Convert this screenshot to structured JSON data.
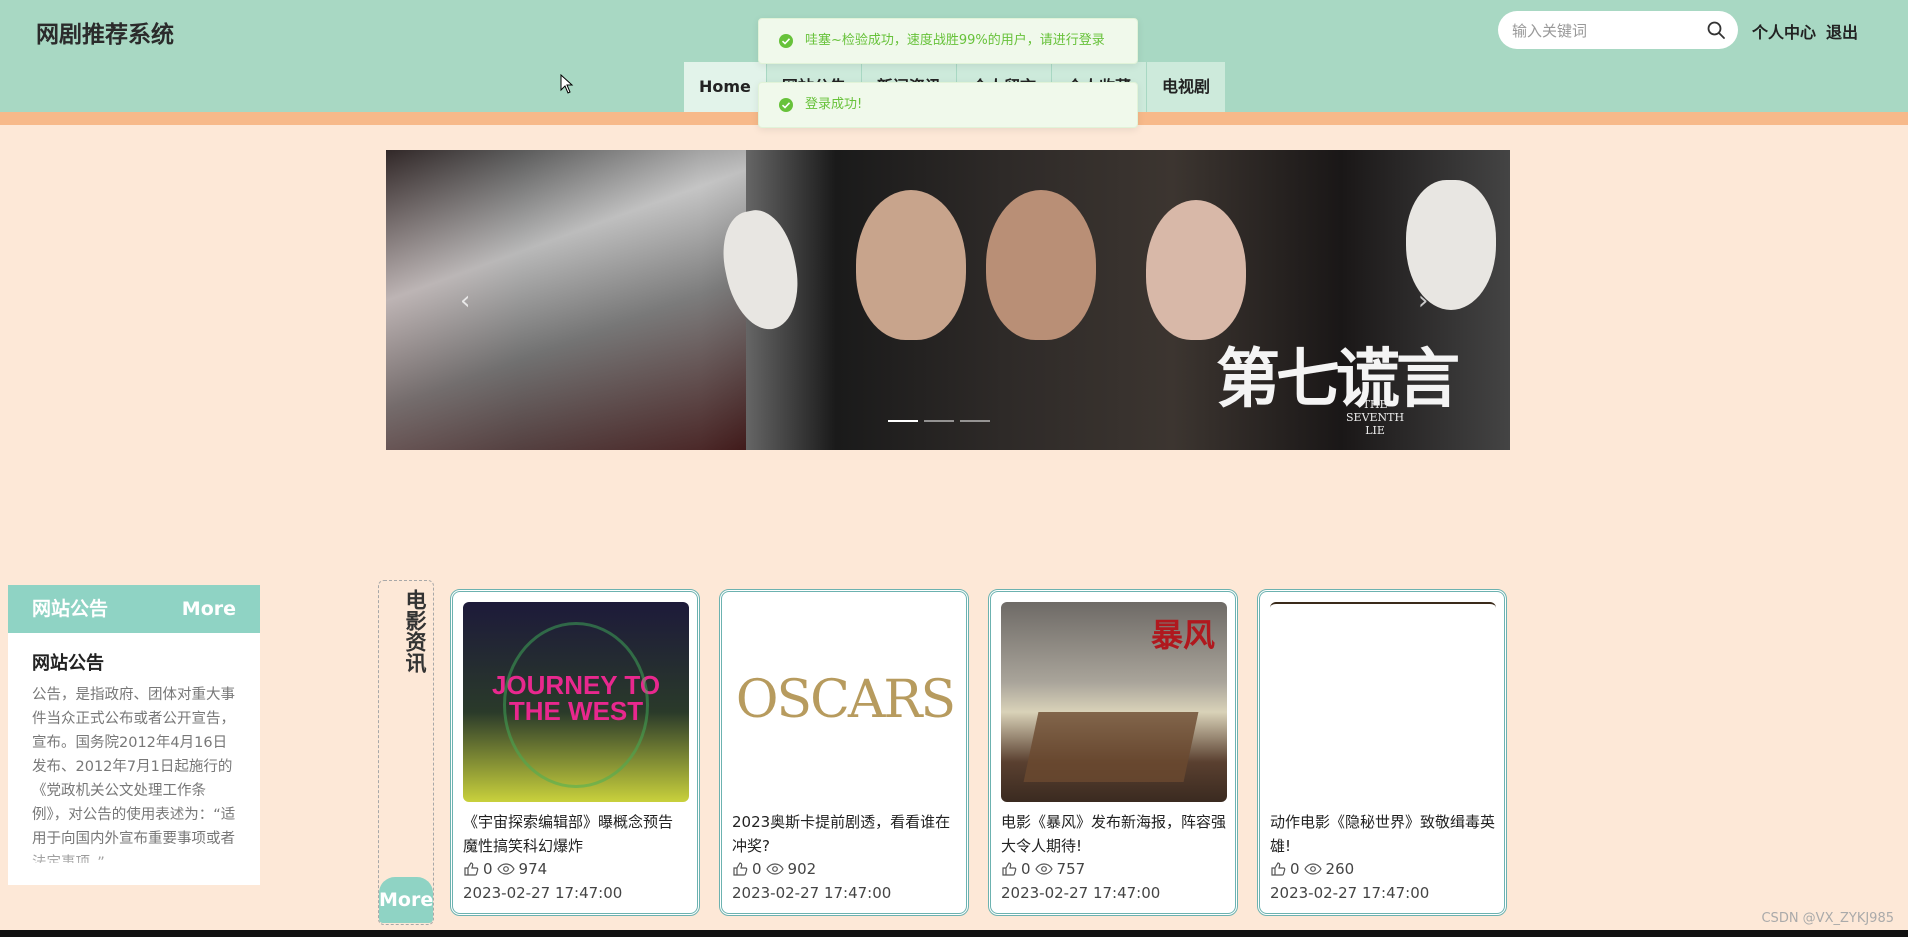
{
  "header": {
    "title": "网剧推荐系统",
    "search_placeholder": "输入关键词",
    "user_center": "个人中心",
    "logout": "退出"
  },
  "nav": {
    "items": [
      {
        "label": "Home"
      },
      {
        "label": "网站公告"
      },
      {
        "label": "新闻资讯"
      },
      {
        "label": "个人留言"
      },
      {
        "label": "个人收藏"
      },
      {
        "label": "电视剧"
      }
    ]
  },
  "toasts": [
    {
      "text": "哇塞~检验成功，速度战胜99%的用户，请进行登录"
    },
    {
      "text": "登录成功!"
    }
  ],
  "banner": {
    "title": "第七谎言",
    "subtitle_lines": [
      "THE",
      "SEVENTH",
      "LIE"
    ],
    "slide_count": 3,
    "active_slide": 1
  },
  "notice": {
    "header": "网站公告",
    "more": "More",
    "title": "网站公告",
    "text": "公告，是指政府、团体对重大事件当众正式公布或者公开宣告，宣布。国务院2012年4月16日发布、2012年7月1日起施行的《党政机关公文处理工作条例》，对公告的使用表述为：“适用于向国内外宣布重要事项或者法定事项。”"
  },
  "news_section": {
    "label": "电影资讯",
    "more": "More",
    "cards": [
      {
        "title": "《宇宙探索编辑部》曝概念预告 魔性搞笑科幻爆炸",
        "likes": "0",
        "views": "974",
        "date": "2023-02-27 17:47:00",
        "poster_text": "JOURNEY TO THE WEST"
      },
      {
        "title": "2023奥斯卡提前剧透，看看谁在冲奖?",
        "likes": "0",
        "views": "902",
        "date": "2023-02-27 17:47:00",
        "poster_text": "OSCARS"
      },
      {
        "title": "电影《暴风》发布新海报，阵容强大令人期待!",
        "likes": "0",
        "views": "757",
        "date": "2023-02-27 17:47:00",
        "poster_text": "暴风"
      },
      {
        "title": "动作电影《隐秘世界》致敬缉毒英雄!",
        "likes": "0",
        "views": "260",
        "date": "2023-02-27 17:47:00",
        "poster_text": ""
      }
    ]
  },
  "watermark": "CSDN @VX_ZYKJ985",
  "colors": {
    "header_bg": "#a8d8c3",
    "stripe": "#f7b98a",
    "page_bg": "#fde8d7",
    "accent": "#8fd3c4",
    "toast_success": "#67c23a"
  }
}
